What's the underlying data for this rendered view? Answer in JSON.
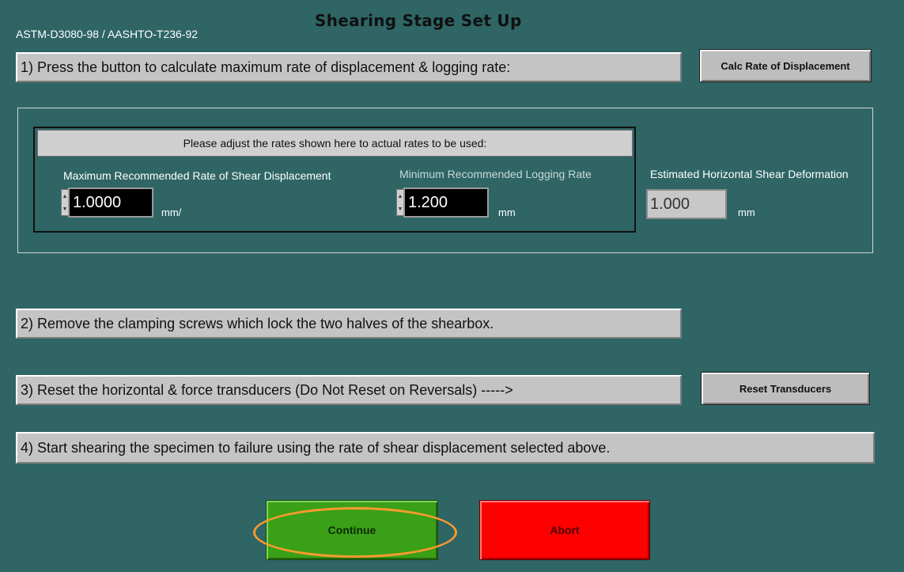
{
  "header": {
    "title": "Shearing Stage Set Up",
    "standard": "ASTM-D3080-98 / AASHTO-T236-92"
  },
  "steps": {
    "step1": "1) Press the button to calculate maximum rate of displacement & logging rate:",
    "step2": "2) Remove the clamping screws which lock the two halves of the shearbox.",
    "step3": "3) Reset the horizontal & force transducers (Do Not Reset on Reversals)  ----->",
    "step4": "4) Start shearing the specimen to failure using the rate of shear displacement selected above."
  },
  "buttons": {
    "calc": "Calc Rate of Displacement",
    "reset": "Reset Transducers",
    "continue": "Continue",
    "abort": "Abort"
  },
  "rates": {
    "header": "Please adjust the rates shown here to actual rates to be used:",
    "max_rate_label": "Maximum Recommended Rate of Shear Displacement",
    "max_rate_value": "1.0000",
    "max_rate_unit": "mm/",
    "min_logging_label": "Minimum Recommended Logging Rate",
    "min_logging_value": "1.200",
    "min_logging_unit": "mm",
    "est_deformation_label": "Estimated Horizontal Shear Deformation",
    "est_deformation_value": "1.000",
    "est_deformation_unit": "mm"
  },
  "colors": {
    "background": "#2f6565",
    "continue": "#3aa018",
    "abort": "#ff0000",
    "highlight": "#ff9a2e"
  }
}
